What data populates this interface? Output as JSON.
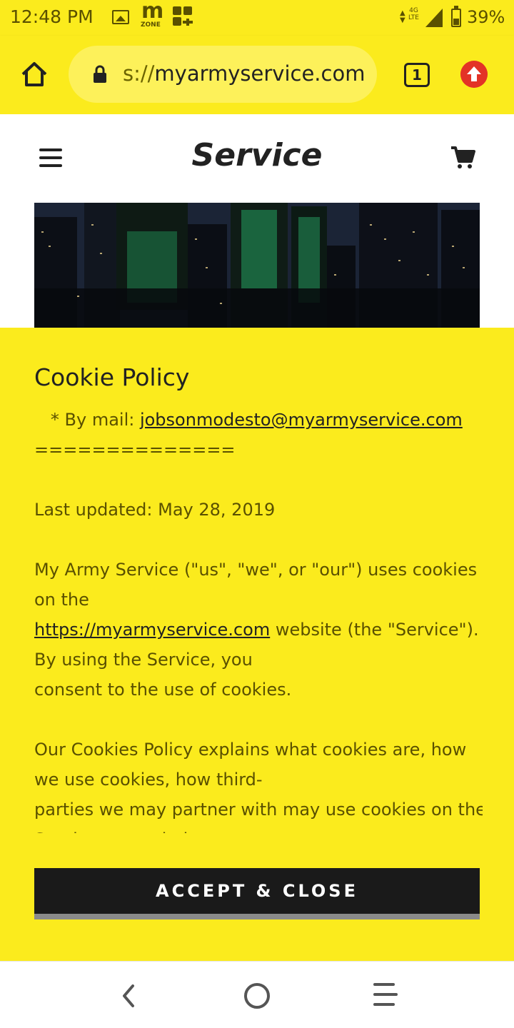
{
  "status_bar": {
    "time": "12:48 PM",
    "network": "4G\nLTE",
    "battery": "39%",
    "icons": [
      "image-icon",
      "mzone-icon",
      "apps-icon",
      "data-arrows-icon",
      "signal-icon",
      "battery-icon"
    ]
  },
  "browser": {
    "url_scheme": "s://",
    "url_host": "myarmyservice.com",
    "tab_count": "1"
  },
  "header": {
    "title": "Service"
  },
  "cookie": {
    "title": "Cookie Policy",
    "mail_prefix": "   * By mail: ",
    "mail_link": "jobsonmodesto@myarmyservice.com",
    "separator": "==============",
    "last_updated": "Last updated: May 28, 2019",
    "para1_line1": "My Army Service (\"us\", \"we\", or \"our\") uses cookies",
    "para1_line2": "on the",
    "para1_link": "https://myarmyservice.com",
    "para1_line3_rest": " website (the \"Service\").",
    "para1_line4": "By using the Service, you",
    "para1_line5": "consent to the use of cookies.",
    "para2_line1": "Our Cookies Policy explains what cookies are, how",
    "para2_line2": "we use cookies, how third-",
    "para2_line3": "parties we may partner with may use cookies on the",
    "para2_line4": "Service, your choices",
    "accept_label": "ACCEPT & CLOSE"
  },
  "colors": {
    "accent_yellow": "#fbeb1d",
    "button_dark": "#1a1a1a",
    "update_red": "#e33326"
  }
}
